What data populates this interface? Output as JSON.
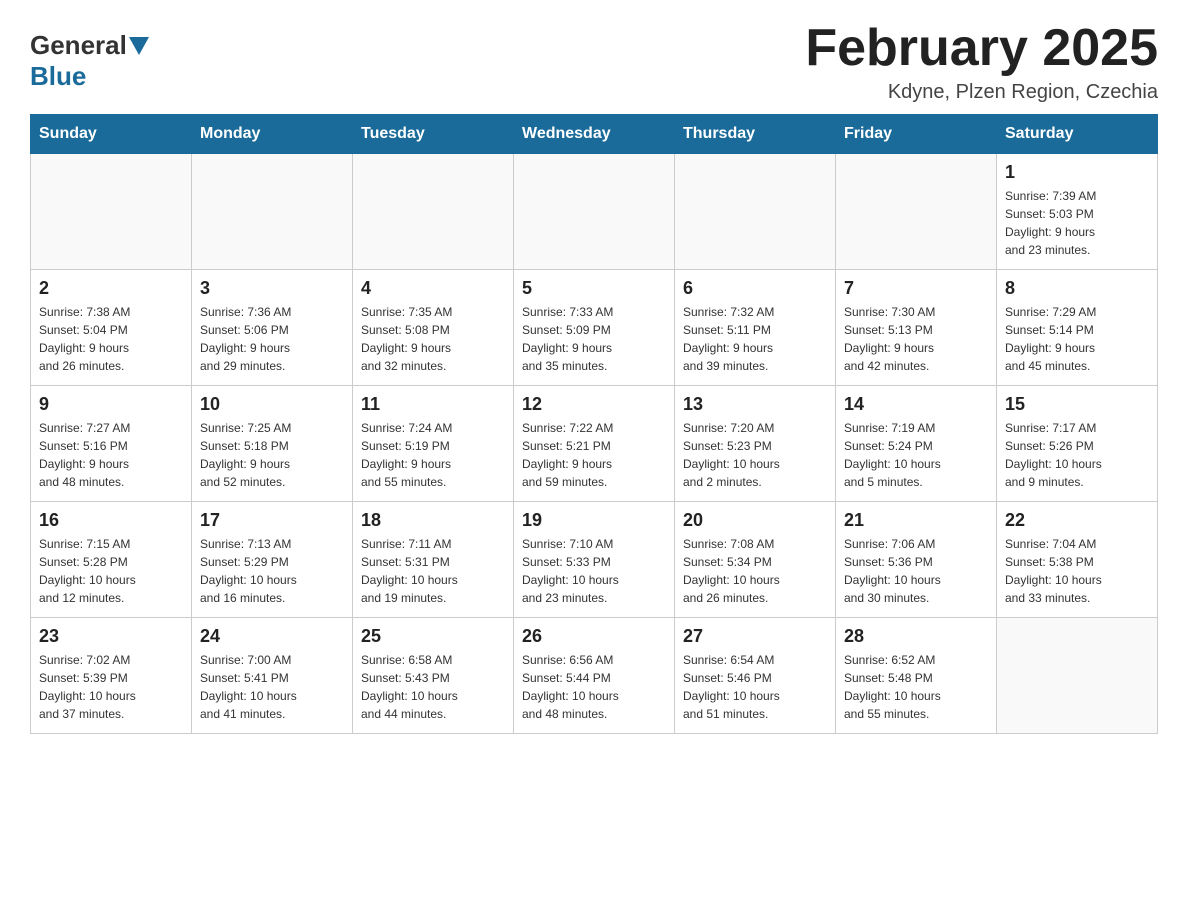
{
  "header": {
    "logo_general": "General",
    "logo_blue": "Blue",
    "month_title": "February 2025",
    "location": "Kdyne, Plzen Region, Czechia"
  },
  "days_of_week": [
    "Sunday",
    "Monday",
    "Tuesday",
    "Wednesday",
    "Thursday",
    "Friday",
    "Saturday"
  ],
  "weeks": [
    {
      "days": [
        {
          "date": "",
          "info": ""
        },
        {
          "date": "",
          "info": ""
        },
        {
          "date": "",
          "info": ""
        },
        {
          "date": "",
          "info": ""
        },
        {
          "date": "",
          "info": ""
        },
        {
          "date": "",
          "info": ""
        },
        {
          "date": "1",
          "info": "Sunrise: 7:39 AM\nSunset: 5:03 PM\nDaylight: 9 hours\nand 23 minutes."
        }
      ]
    },
    {
      "days": [
        {
          "date": "2",
          "info": "Sunrise: 7:38 AM\nSunset: 5:04 PM\nDaylight: 9 hours\nand 26 minutes."
        },
        {
          "date": "3",
          "info": "Sunrise: 7:36 AM\nSunset: 5:06 PM\nDaylight: 9 hours\nand 29 minutes."
        },
        {
          "date": "4",
          "info": "Sunrise: 7:35 AM\nSunset: 5:08 PM\nDaylight: 9 hours\nand 32 minutes."
        },
        {
          "date": "5",
          "info": "Sunrise: 7:33 AM\nSunset: 5:09 PM\nDaylight: 9 hours\nand 35 minutes."
        },
        {
          "date": "6",
          "info": "Sunrise: 7:32 AM\nSunset: 5:11 PM\nDaylight: 9 hours\nand 39 minutes."
        },
        {
          "date": "7",
          "info": "Sunrise: 7:30 AM\nSunset: 5:13 PM\nDaylight: 9 hours\nand 42 minutes."
        },
        {
          "date": "8",
          "info": "Sunrise: 7:29 AM\nSunset: 5:14 PM\nDaylight: 9 hours\nand 45 minutes."
        }
      ]
    },
    {
      "days": [
        {
          "date": "9",
          "info": "Sunrise: 7:27 AM\nSunset: 5:16 PM\nDaylight: 9 hours\nand 48 minutes."
        },
        {
          "date": "10",
          "info": "Sunrise: 7:25 AM\nSunset: 5:18 PM\nDaylight: 9 hours\nand 52 minutes."
        },
        {
          "date": "11",
          "info": "Sunrise: 7:24 AM\nSunset: 5:19 PM\nDaylight: 9 hours\nand 55 minutes."
        },
        {
          "date": "12",
          "info": "Sunrise: 7:22 AM\nSunset: 5:21 PM\nDaylight: 9 hours\nand 59 minutes."
        },
        {
          "date": "13",
          "info": "Sunrise: 7:20 AM\nSunset: 5:23 PM\nDaylight: 10 hours\nand 2 minutes."
        },
        {
          "date": "14",
          "info": "Sunrise: 7:19 AM\nSunset: 5:24 PM\nDaylight: 10 hours\nand 5 minutes."
        },
        {
          "date": "15",
          "info": "Sunrise: 7:17 AM\nSunset: 5:26 PM\nDaylight: 10 hours\nand 9 minutes."
        }
      ]
    },
    {
      "days": [
        {
          "date": "16",
          "info": "Sunrise: 7:15 AM\nSunset: 5:28 PM\nDaylight: 10 hours\nand 12 minutes."
        },
        {
          "date": "17",
          "info": "Sunrise: 7:13 AM\nSunset: 5:29 PM\nDaylight: 10 hours\nand 16 minutes."
        },
        {
          "date": "18",
          "info": "Sunrise: 7:11 AM\nSunset: 5:31 PM\nDaylight: 10 hours\nand 19 minutes."
        },
        {
          "date": "19",
          "info": "Sunrise: 7:10 AM\nSunset: 5:33 PM\nDaylight: 10 hours\nand 23 minutes."
        },
        {
          "date": "20",
          "info": "Sunrise: 7:08 AM\nSunset: 5:34 PM\nDaylight: 10 hours\nand 26 minutes."
        },
        {
          "date": "21",
          "info": "Sunrise: 7:06 AM\nSunset: 5:36 PM\nDaylight: 10 hours\nand 30 minutes."
        },
        {
          "date": "22",
          "info": "Sunrise: 7:04 AM\nSunset: 5:38 PM\nDaylight: 10 hours\nand 33 minutes."
        }
      ]
    },
    {
      "days": [
        {
          "date": "23",
          "info": "Sunrise: 7:02 AM\nSunset: 5:39 PM\nDaylight: 10 hours\nand 37 minutes."
        },
        {
          "date": "24",
          "info": "Sunrise: 7:00 AM\nSunset: 5:41 PM\nDaylight: 10 hours\nand 41 minutes."
        },
        {
          "date": "25",
          "info": "Sunrise: 6:58 AM\nSunset: 5:43 PM\nDaylight: 10 hours\nand 44 minutes."
        },
        {
          "date": "26",
          "info": "Sunrise: 6:56 AM\nSunset: 5:44 PM\nDaylight: 10 hours\nand 48 minutes."
        },
        {
          "date": "27",
          "info": "Sunrise: 6:54 AM\nSunset: 5:46 PM\nDaylight: 10 hours\nand 51 minutes."
        },
        {
          "date": "28",
          "info": "Sunrise: 6:52 AM\nSunset: 5:48 PM\nDaylight: 10 hours\nand 55 minutes."
        },
        {
          "date": "",
          "info": ""
        }
      ]
    }
  ]
}
